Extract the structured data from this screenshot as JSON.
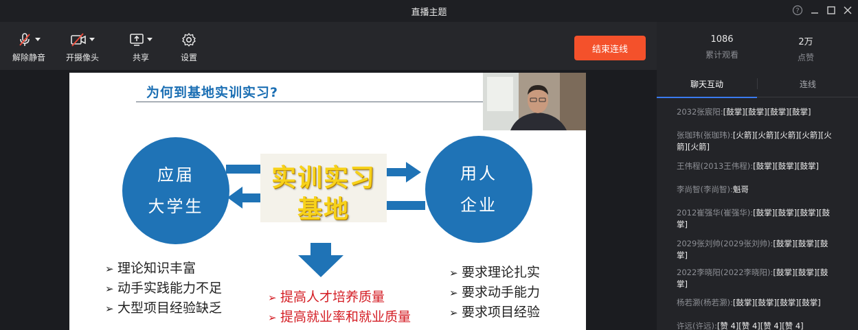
{
  "window": {
    "title": "直播主题"
  },
  "toolbar": {
    "mic_label": "解除静音",
    "camera_label": "开摄像头",
    "share_label": "共享",
    "settings_label": "设置",
    "end_label": "结束连线",
    "end_color": "#f4512b"
  },
  "stats": {
    "views": "1086",
    "views_label": "累计观看",
    "likes": "2万",
    "likes_label": "点赞"
  },
  "tabs": {
    "chat": "聊天互动",
    "connect": "连线",
    "active_color": "#3a7bf0"
  },
  "slide": {
    "title": "为何到基地实训实习?",
    "left_circle": [
      "应届",
      "大学生"
    ],
    "right_circle": [
      "用人",
      "企业"
    ],
    "center": [
      "实训实习",
      "基地"
    ],
    "left_bullets": [
      "理论知识丰富",
      "动手实践能力不足",
      "大型项目经验缺乏"
    ],
    "center_bullets": [
      "提高人才培养质量",
      "提高就业率和就业质量"
    ],
    "right_bullets": [
      "要求理论扎实",
      "要求动手能力",
      "要求项目经验"
    ],
    "bullet_glyph": "➢",
    "circle_color": "#1f73b6"
  },
  "chat": [
    {
      "user": "2032张宸阳:",
      "text": "[鼓掌][鼓掌][鼓掌][鼓掌]"
    },
    {
      "user": "张珈玮(张珈玮):",
      "text": "[火箭][火箭][火箭][火箭][火箭][火箭]"
    },
    {
      "user": "王伟程(2013王伟程):",
      "text": "[鼓掌][鼓掌][鼓掌]"
    },
    {
      "user": "李尚智(李尚智):",
      "text": "魁哥"
    },
    {
      "user": "2012崔强华(崔强华):",
      "text": "[鼓掌][鼓掌][鼓掌][鼓掌]"
    },
    {
      "user": "2029张刘帅(2029张刘帅):",
      "text": "[鼓掌][鼓掌][鼓掌]"
    },
    {
      "user": "2022李晓阳(2022李晓阳):",
      "text": "[鼓掌][鼓掌][鼓掌]"
    },
    {
      "user": "杨若灏(杨若灏):",
      "text": "[鼓掌][鼓掌][鼓掌][鼓掌]"
    },
    {
      "user": "许远(许远):",
      "text": "[赞 4][赞 4][赞 4][赞 4]"
    }
  ]
}
